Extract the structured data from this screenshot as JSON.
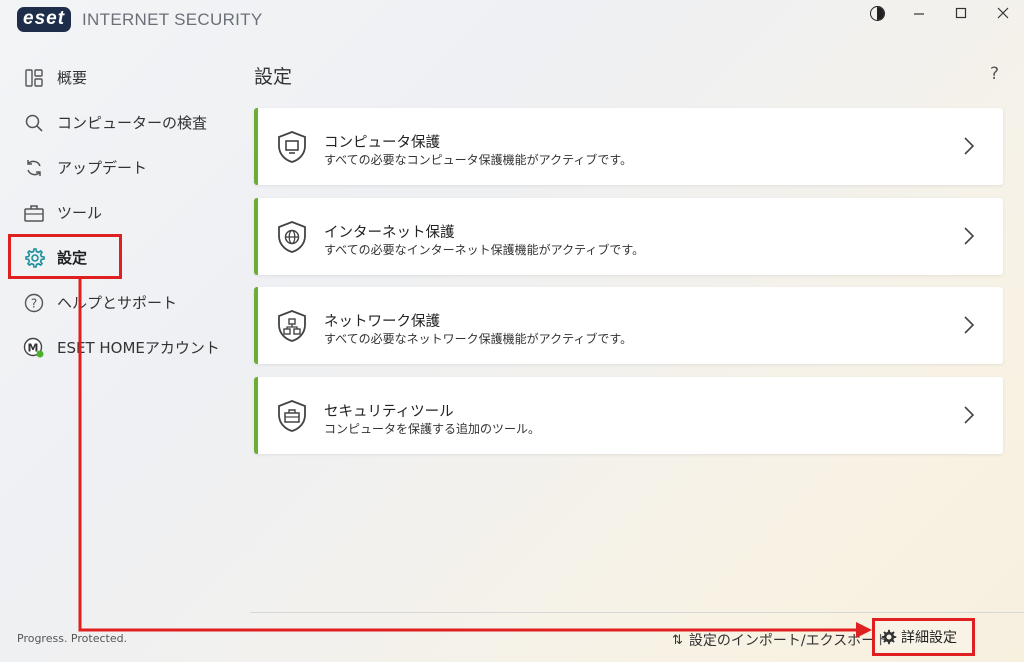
{
  "app": {
    "logo_text": "eset",
    "product": "INTERNET SECURITY",
    "footer_status": "Progress. Protected."
  },
  "sidebar": {
    "items": [
      {
        "label": "概要",
        "icon": "dashboard-icon"
      },
      {
        "label": "コンピューターの検査",
        "icon": "search-icon"
      },
      {
        "label": "アップデート",
        "icon": "refresh-icon"
      },
      {
        "label": "ツール",
        "icon": "toolbox-icon"
      },
      {
        "label": "設定",
        "icon": "gear-icon",
        "active": true
      },
      {
        "label": "ヘルプとサポート",
        "icon": "help-icon"
      },
      {
        "label": "ESET HOMEアカウント",
        "icon": "account-icon"
      }
    ]
  },
  "main": {
    "title": "設定",
    "help": "?",
    "cards": [
      {
        "title": "コンピュータ保護",
        "desc": "すべての必要なコンピュータ保護機能がアクティブです。",
        "icon": "computer-shield-icon"
      },
      {
        "title": "インターネット保護",
        "desc": "すべての必要なインターネット保護機能がアクティブです。",
        "icon": "globe-shield-icon"
      },
      {
        "title": "ネットワーク保護",
        "desc": "すべての必要なネットワーク保護機能がアクティブです。",
        "icon": "network-shield-icon"
      },
      {
        "title": "セキュリティツール",
        "desc": "コンピュータを保護する追加のツール。",
        "icon": "toolbox-shield-icon"
      }
    ]
  },
  "footer": {
    "import_export": "設定のインポート/エクスポート",
    "advanced": "詳細設定"
  },
  "colors": {
    "accent_green": "#6cae35",
    "highlight_red": "#e02020",
    "logo_navy": "#1e2e4a"
  }
}
